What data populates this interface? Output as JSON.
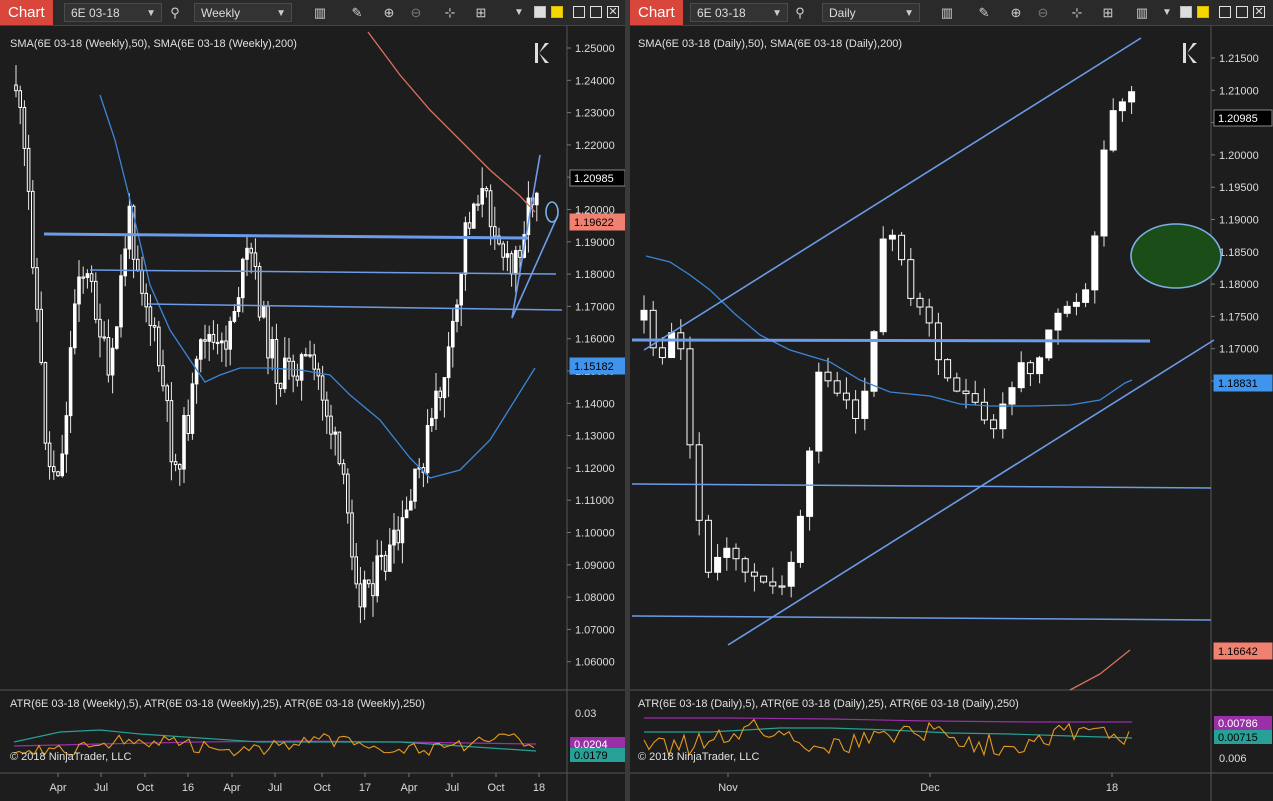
{
  "colors": {
    "up": "#ffffff",
    "down": "#ffffff",
    "sma50": "#3a86d8",
    "sma200": "#d8735f",
    "trend": "#6c9be8",
    "ellipse_fill": "#1b4d18",
    "ellipse_stroke": "#7bb0e6",
    "atr5": "#e89a1c",
    "atr25": "#27a096",
    "atr250": "#9b2fa8",
    "accent": "#d9463c"
  },
  "left": {
    "tab": "Chart",
    "instrument": "6E 03-18",
    "period": "Weekly",
    "indicator_label": "SMA(6E 03-18 (Weekly),50), SMA(6E 03-18 (Weekly),200)",
    "atr_label": "ATR(6E 03-18 (Weekly),5), ATR(6E 03-18 (Weekly),25), ATR(6E 03-18 (Weekly),250)",
    "copyright": "© 2018 NinjaTrader, LLC",
    "price_ticks": [
      "1.25000",
      "1.24000",
      "1.23000",
      "1.22000",
      "1.21000",
      "1.20000",
      "1.19000",
      "1.18000",
      "1.17000",
      "1.16000",
      "1.15000",
      "1.14000",
      "1.13000",
      "1.12000",
      "1.11000",
      "1.10000",
      "1.09000",
      "1.08000",
      "1.07000",
      "1.06000"
    ],
    "price_markers": [
      {
        "value": "1.20985",
        "kind": "last"
      },
      {
        "value": "1.19622",
        "kind": "sma200"
      },
      {
        "value": "1.15182",
        "kind": "sma50"
      }
    ],
    "atr_ticks": [
      "0.03"
    ],
    "atr_markers": [
      {
        "value": "0.0204",
        "kind": "atr250"
      },
      {
        "value": "0.0179",
        "kind": "atr25"
      }
    ],
    "time_labels": [
      "Apr",
      "Jul",
      "Oct",
      "16",
      "Apr",
      "Jul",
      "Oct",
      "17",
      "Apr",
      "Jul",
      "Oct",
      "18"
    ]
  },
  "right": {
    "tab": "Chart",
    "instrument": "6E 03-18",
    "period": "Daily",
    "indicator_label": "SMA(6E 03-18 (Daily),50), SMA(6E 03-18 (Daily),200)",
    "atr_label": "ATR(6E 03-18 (Daily),5), ATR(6E 03-18 (Daily),25), ATR(6E 03-18 (Daily),250)",
    "copyright": "© 2018 NinjaTrader, LLC",
    "price_ticks": [
      "1.21500",
      "1.21000",
      "1.20500",
      "1.20000",
      "1.19500",
      "1.19000",
      "1.18500",
      "1.18000",
      "1.17500",
      "1.17000",
      "1.16500"
    ],
    "price_markers": [
      {
        "value": "1.20985",
        "kind": "last"
      },
      {
        "value": "1.18831",
        "kind": "sma50"
      },
      {
        "value": "1.16642",
        "kind": "sma200"
      }
    ],
    "atr_ticks": [
      "0.006"
    ],
    "atr_markers": [
      {
        "value": "0.00786",
        "kind": "atr250"
      },
      {
        "value": "0.00715",
        "kind": "atr25"
      }
    ],
    "time_labels": [
      "Nov",
      "Dec",
      "18"
    ]
  }
}
